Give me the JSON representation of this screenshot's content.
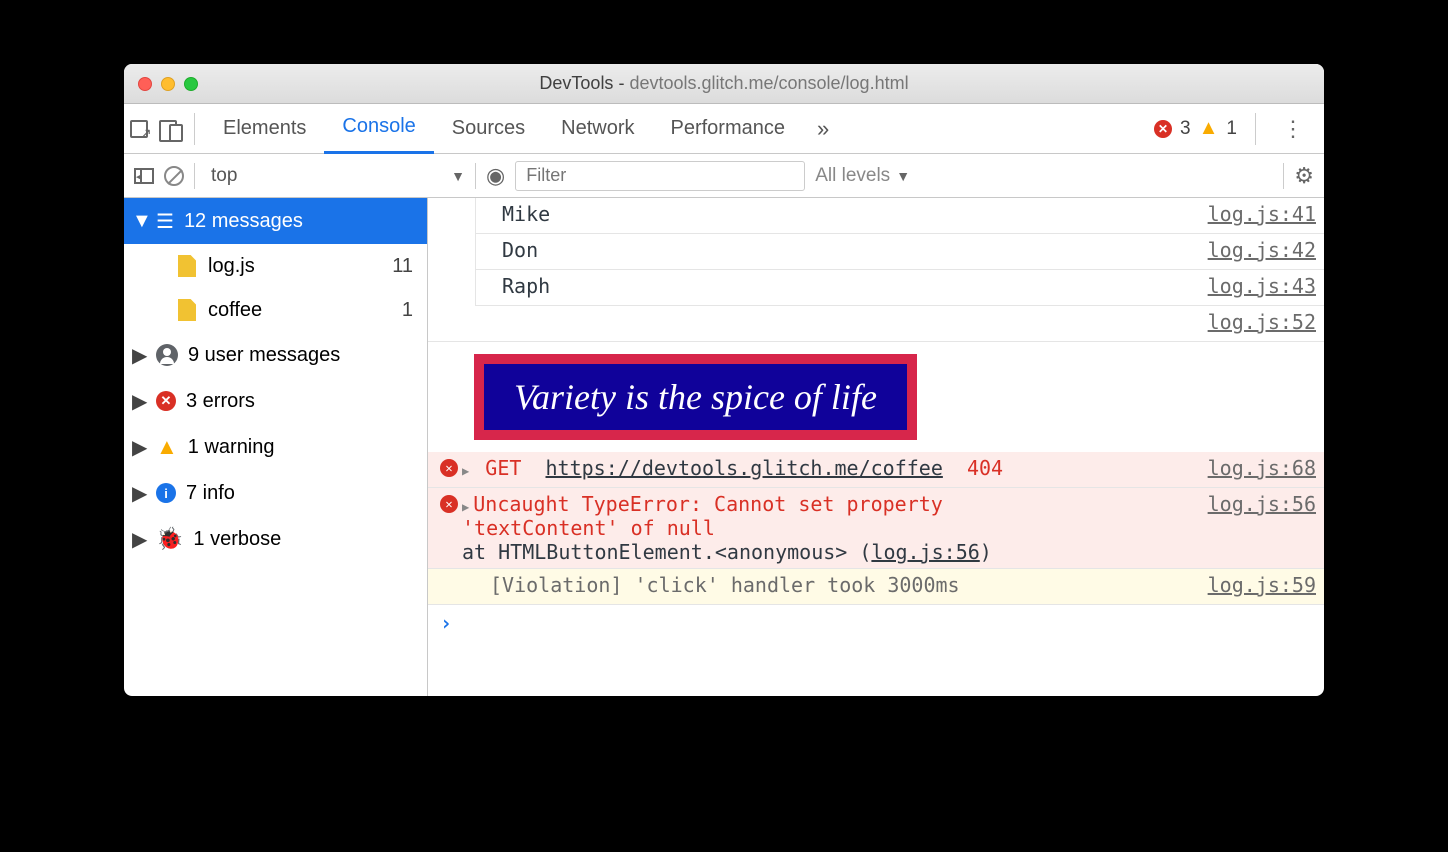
{
  "window": {
    "title_prefix": "DevTools - ",
    "title_url": "devtools.glitch.me/console/log.html"
  },
  "tabs": {
    "elements": "Elements",
    "console": "Console",
    "sources": "Sources",
    "network": "Network",
    "performance": "Performance",
    "more": "»",
    "error_count": "3",
    "warn_count": "1"
  },
  "toolbar": {
    "context": "top",
    "filter_placeholder": "Filter",
    "levels": "All levels"
  },
  "sidebar": {
    "head": "12 messages",
    "file1": {
      "name": "log.js",
      "count": "11"
    },
    "file2": {
      "name": "coffee",
      "count": "1"
    },
    "user": {
      "label": "9 user messages"
    },
    "errors": {
      "label": "3 errors"
    },
    "warn": {
      "label": "1 warning"
    },
    "info": {
      "label": "7 info"
    },
    "verbose": {
      "label": "1 verbose"
    }
  },
  "logs": {
    "r1": {
      "msg": "Mike",
      "src": "log.js:41"
    },
    "r2": {
      "msg": "Don",
      "src": "log.js:42"
    },
    "r3": {
      "msg": "Raph",
      "src": "log.js:43"
    },
    "r4": {
      "src": "log.js:52"
    },
    "styled": "Variety is the spice of life",
    "e1": {
      "method": "GET",
      "url": "https://devtools.glitch.me/coffee",
      "code": "404",
      "src": "log.js:68"
    },
    "e2": {
      "line1": "Uncaught TypeError: Cannot set property",
      "line2": "'textContent' of null",
      "stack_pre": "    at HTMLButtonElement.<anonymous> (",
      "stack_link": "log.js:56",
      "stack_post": ")",
      "src": "log.js:56"
    },
    "v1": {
      "msg": "[Violation] 'click' handler took 3000ms",
      "src": "log.js:59"
    }
  }
}
